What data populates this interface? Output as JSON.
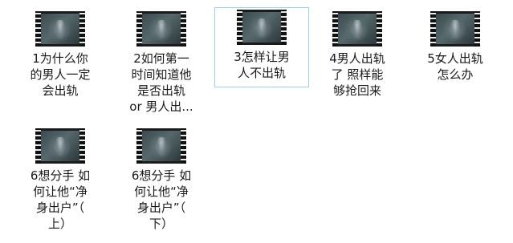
{
  "files": [
    {
      "name": "video-file-1",
      "label": "1为什么你\n的男人一定\n会出轨",
      "selected": false
    },
    {
      "name": "video-file-2",
      "label": "2如何第一\n时间知道他\n是否出轨\nor 男人出...",
      "selected": false
    },
    {
      "name": "video-file-3",
      "label": "3怎样让男\n人不出轨",
      "selected": true
    },
    {
      "name": "video-file-4",
      "label": "4男人出轨\n了 照样能\n够抢回来",
      "selected": false
    },
    {
      "name": "video-file-5",
      "label": "5女人出轨\n怎么办",
      "selected": false
    },
    {
      "name": "video-file-6a",
      "label": "6想分手 如\n何让他“净\n身出户”（\n上）",
      "selected": false
    },
    {
      "name": "video-file-6b",
      "label": "6想分手 如\n何让他“净\n身出户”（\n下）",
      "selected": false
    }
  ],
  "icons": {
    "thumbnail": "video-thumbnail-icon"
  }
}
